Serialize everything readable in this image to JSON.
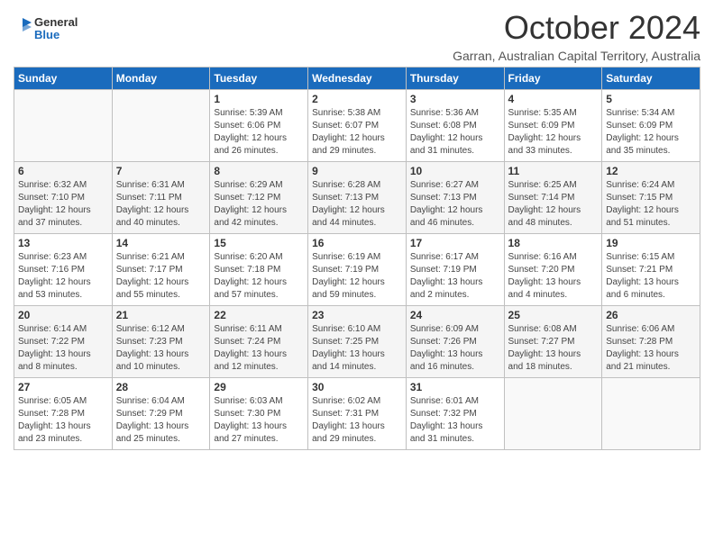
{
  "logo": {
    "general": "General",
    "blue": "Blue"
  },
  "title": "October 2024",
  "subtitle": "Garran, Australian Capital Territory, Australia",
  "headers": [
    "Sunday",
    "Monday",
    "Tuesday",
    "Wednesday",
    "Thursday",
    "Friday",
    "Saturday"
  ],
  "weeks": [
    [
      {
        "day": "",
        "info": ""
      },
      {
        "day": "",
        "info": ""
      },
      {
        "day": "1",
        "info": "Sunrise: 5:39 AM\nSunset: 6:06 PM\nDaylight: 12 hours\nand 26 minutes."
      },
      {
        "day": "2",
        "info": "Sunrise: 5:38 AM\nSunset: 6:07 PM\nDaylight: 12 hours\nand 29 minutes."
      },
      {
        "day": "3",
        "info": "Sunrise: 5:36 AM\nSunset: 6:08 PM\nDaylight: 12 hours\nand 31 minutes."
      },
      {
        "day": "4",
        "info": "Sunrise: 5:35 AM\nSunset: 6:09 PM\nDaylight: 12 hours\nand 33 minutes."
      },
      {
        "day": "5",
        "info": "Sunrise: 5:34 AM\nSunset: 6:09 PM\nDaylight: 12 hours\nand 35 minutes."
      }
    ],
    [
      {
        "day": "6",
        "info": "Sunrise: 6:32 AM\nSunset: 7:10 PM\nDaylight: 12 hours\nand 37 minutes."
      },
      {
        "day": "7",
        "info": "Sunrise: 6:31 AM\nSunset: 7:11 PM\nDaylight: 12 hours\nand 40 minutes."
      },
      {
        "day": "8",
        "info": "Sunrise: 6:29 AM\nSunset: 7:12 PM\nDaylight: 12 hours\nand 42 minutes."
      },
      {
        "day": "9",
        "info": "Sunrise: 6:28 AM\nSunset: 7:13 PM\nDaylight: 12 hours\nand 44 minutes."
      },
      {
        "day": "10",
        "info": "Sunrise: 6:27 AM\nSunset: 7:13 PM\nDaylight: 12 hours\nand 46 minutes."
      },
      {
        "day": "11",
        "info": "Sunrise: 6:25 AM\nSunset: 7:14 PM\nDaylight: 12 hours\nand 48 minutes."
      },
      {
        "day": "12",
        "info": "Sunrise: 6:24 AM\nSunset: 7:15 PM\nDaylight: 12 hours\nand 51 minutes."
      }
    ],
    [
      {
        "day": "13",
        "info": "Sunrise: 6:23 AM\nSunset: 7:16 PM\nDaylight: 12 hours\nand 53 minutes."
      },
      {
        "day": "14",
        "info": "Sunrise: 6:21 AM\nSunset: 7:17 PM\nDaylight: 12 hours\nand 55 minutes."
      },
      {
        "day": "15",
        "info": "Sunrise: 6:20 AM\nSunset: 7:18 PM\nDaylight: 12 hours\nand 57 minutes."
      },
      {
        "day": "16",
        "info": "Sunrise: 6:19 AM\nSunset: 7:19 PM\nDaylight: 12 hours\nand 59 minutes."
      },
      {
        "day": "17",
        "info": "Sunrise: 6:17 AM\nSunset: 7:19 PM\nDaylight: 13 hours\nand 2 minutes."
      },
      {
        "day": "18",
        "info": "Sunrise: 6:16 AM\nSunset: 7:20 PM\nDaylight: 13 hours\nand 4 minutes."
      },
      {
        "day": "19",
        "info": "Sunrise: 6:15 AM\nSunset: 7:21 PM\nDaylight: 13 hours\nand 6 minutes."
      }
    ],
    [
      {
        "day": "20",
        "info": "Sunrise: 6:14 AM\nSunset: 7:22 PM\nDaylight: 13 hours\nand 8 minutes."
      },
      {
        "day": "21",
        "info": "Sunrise: 6:12 AM\nSunset: 7:23 PM\nDaylight: 13 hours\nand 10 minutes."
      },
      {
        "day": "22",
        "info": "Sunrise: 6:11 AM\nSunset: 7:24 PM\nDaylight: 13 hours\nand 12 minutes."
      },
      {
        "day": "23",
        "info": "Sunrise: 6:10 AM\nSunset: 7:25 PM\nDaylight: 13 hours\nand 14 minutes."
      },
      {
        "day": "24",
        "info": "Sunrise: 6:09 AM\nSunset: 7:26 PM\nDaylight: 13 hours\nand 16 minutes."
      },
      {
        "day": "25",
        "info": "Sunrise: 6:08 AM\nSunset: 7:27 PM\nDaylight: 13 hours\nand 18 minutes."
      },
      {
        "day": "26",
        "info": "Sunrise: 6:06 AM\nSunset: 7:28 PM\nDaylight: 13 hours\nand 21 minutes."
      }
    ],
    [
      {
        "day": "27",
        "info": "Sunrise: 6:05 AM\nSunset: 7:28 PM\nDaylight: 13 hours\nand 23 minutes."
      },
      {
        "day": "28",
        "info": "Sunrise: 6:04 AM\nSunset: 7:29 PM\nDaylight: 13 hours\nand 25 minutes."
      },
      {
        "day": "29",
        "info": "Sunrise: 6:03 AM\nSunset: 7:30 PM\nDaylight: 13 hours\nand 27 minutes."
      },
      {
        "day": "30",
        "info": "Sunrise: 6:02 AM\nSunset: 7:31 PM\nDaylight: 13 hours\nand 29 minutes."
      },
      {
        "day": "31",
        "info": "Sunrise: 6:01 AM\nSunset: 7:32 PM\nDaylight: 13 hours\nand 31 minutes."
      },
      {
        "day": "",
        "info": ""
      },
      {
        "day": "",
        "info": ""
      }
    ]
  ]
}
